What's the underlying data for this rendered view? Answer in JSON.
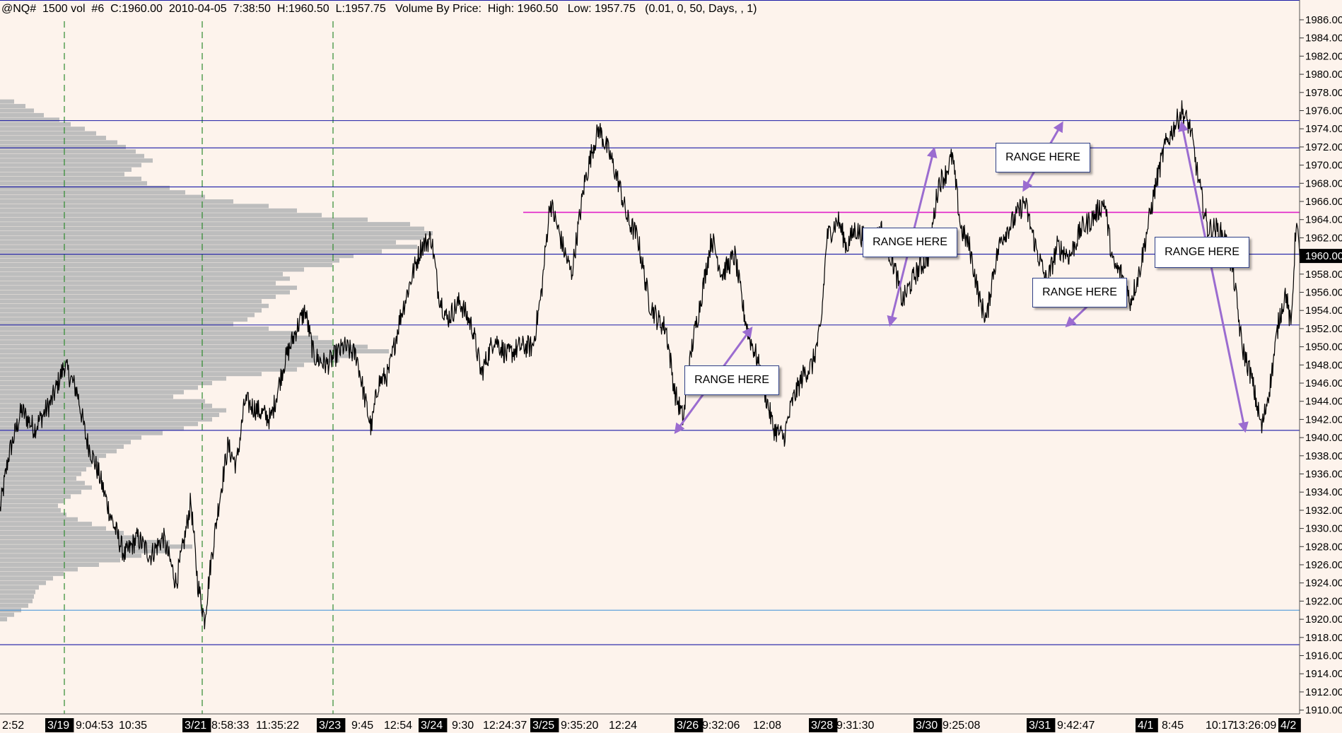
{
  "header": {
    "text": "@NQ#  1500 vol  #6  C:1960.00  2010-04-05  7:38:50  H:1960.50  L:1957.75   Volume By Price:  High: 1960.50   Low: 1957.75   (0.01, 0, 50, Days, , 1)"
  },
  "colors": {
    "background": "#fdf3ec",
    "price_line": "#000000",
    "profile_bars": "#bdbdbd",
    "support_lines": "#1a1aa6",
    "light_line": "#3a8fd8",
    "magenta_line": "#e020c8",
    "session_lines": "#2e8b2e",
    "arrows": "#9b6cd0",
    "current_price_tag": "#000000"
  },
  "annotations": [
    {
      "label": "RANGE HERE"
    },
    {
      "label": "RANGE HERE"
    },
    {
      "label": "RANGE HERE"
    },
    {
      "label": "RANGE HERE"
    },
    {
      "label": "RANGE HERE"
    }
  ],
  "chart_data": {
    "type": "line",
    "ylim": [
      1909.5,
      1987.5
    ],
    "y_ticks": [
      "1986.00",
      "1984.00",
      "1982.00",
      "1980.00",
      "1978.00",
      "1976.00",
      "1974.00",
      "1972.00",
      "1970.00",
      "1968.00",
      "1966.00",
      "1964.00",
      "1962.00",
      "1960.00",
      "1958.00",
      "1956.00",
      "1954.00",
      "1952.00",
      "1950.00",
      "1948.00",
      "1946.00",
      "1944.00",
      "1942.00",
      "1940.00",
      "1938.00",
      "1936.00",
      "1934.00",
      "1932.00",
      "1930.00",
      "1928.00",
      "1926.00",
      "1924.00",
      "1922.00",
      "1920.00",
      "1918.00",
      "1916.00",
      "1914.00",
      "1912.00",
      "1910.00"
    ],
    "current_price": "1960.00",
    "x_labels": [
      {
        "text": "2:52",
        "boxed": false
      },
      {
        "text": "3/19",
        "boxed": true
      },
      {
        "text": "9:04:53",
        "boxed": false
      },
      {
        "text": "10:35",
        "boxed": false
      },
      {
        "text": "3/21",
        "boxed": true
      },
      {
        "text": "8:58:33",
        "boxed": false
      },
      {
        "text": "11:35:22",
        "boxed": false
      },
      {
        "text": "3/23",
        "boxed": true
      },
      {
        "text": "9:45",
        "boxed": false
      },
      {
        "text": "12:54",
        "boxed": false
      },
      {
        "text": "3/24",
        "boxed": true
      },
      {
        "text": "9:30",
        "boxed": false
      },
      {
        "text": "12:24:37",
        "boxed": false
      },
      {
        "text": "3/25",
        "boxed": true
      },
      {
        "text": "9:35:20",
        "boxed": false
      },
      {
        "text": "12:24",
        "boxed": false
      },
      {
        "text": "3/26",
        "boxed": true
      },
      {
        "text": "9:32:06",
        "boxed": false
      },
      {
        "text": "12:08",
        "boxed": false
      },
      {
        "text": "3/28",
        "boxed": true
      },
      {
        "text": "9:31:30",
        "boxed": false
      },
      {
        "text": "3/30",
        "boxed": true
      },
      {
        "text": "9:25:08",
        "boxed": false
      },
      {
        "text": "3/31",
        "boxed": true
      },
      {
        "text": "9:42:47",
        "boxed": false
      },
      {
        "text": "4/1",
        "boxed": true
      },
      {
        "text": "8:45",
        "boxed": false
      },
      {
        "text": "10:17",
        "boxed": false
      },
      {
        "text": "13:26:09",
        "boxed": false
      },
      {
        "text": "4/2",
        "boxed": true
      }
    ],
    "horizontal_levels": [
      {
        "price": 1974.9,
        "style": "dark"
      },
      {
        "price": 1971.9,
        "style": "dark"
      },
      {
        "price": 1967.6,
        "style": "dark"
      },
      {
        "price": 1964.8,
        "style": "magenta"
      },
      {
        "price": 1960.2,
        "style": "dark"
      },
      {
        "price": 1952.4,
        "style": "dark"
      },
      {
        "price": 1940.8,
        "style": "dark"
      },
      {
        "price": 1921.0,
        "style": "light"
      },
      {
        "price": 1917.2,
        "style": "dark"
      }
    ],
    "price_keypoints": [
      [
        0,
        1932
      ],
      [
        10,
        1938
      ],
      [
        25,
        1943
      ],
      [
        40,
        1941
      ],
      [
        60,
        1944
      ],
      [
        75,
        1948
      ],
      [
        90,
        1945
      ],
      [
        100,
        1940
      ],
      [
        115,
        1936
      ],
      [
        130,
        1931
      ],
      [
        145,
        1927
      ],
      [
        160,
        1929
      ],
      [
        175,
        1927
      ],
      [
        190,
        1929
      ],
      [
        205,
        1924
      ],
      [
        215,
        1929
      ],
      [
        222,
        1933
      ],
      [
        230,
        1924
      ],
      [
        238,
        1920
      ],
      [
        245,
        1926
      ],
      [
        255,
        1933
      ],
      [
        265,
        1939
      ],
      [
        275,
        1937
      ],
      [
        285,
        1944
      ],
      [
        300,
        1943
      ],
      [
        315,
        1942
      ],
      [
        330,
        1948
      ],
      [
        345,
        1952
      ],
      [
        355,
        1954
      ],
      [
        365,
        1949
      ],
      [
        380,
        1948
      ],
      [
        400,
        1950
      ],
      [
        415,
        1949
      ],
      [
        425,
        1944
      ],
      [
        432,
        1941
      ],
      [
        440,
        1946
      ],
      [
        452,
        1947
      ],
      [
        465,
        1953
      ],
      [
        480,
        1958
      ],
      [
        490,
        1961
      ],
      [
        502,
        1962
      ],
      [
        510,
        1956
      ],
      [
        520,
        1953
      ],
      [
        535,
        1955
      ],
      [
        550,
        1952
      ],
      [
        560,
        1947
      ],
      [
        575,
        1951
      ],
      [
        590,
        1949
      ],
      [
        605,
        1950
      ],
      [
        620,
        1950
      ],
      [
        630,
        1956
      ],
      [
        640,
        1966
      ],
      [
        655,
        1961
      ],
      [
        665,
        1958
      ],
      [
        680,
        1968
      ],
      [
        690,
        1972
      ],
      [
        697,
        1974
      ],
      [
        710,
        1971
      ],
      [
        720,
        1968
      ],
      [
        730,
        1964
      ],
      [
        742,
        1962
      ],
      [
        755,
        1955
      ],
      [
        765,
        1953
      ],
      [
        775,
        1952
      ],
      [
        785,
        1945
      ],
      [
        795,
        1942
      ],
      [
        805,
        1950
      ],
      [
        815,
        1955
      ],
      [
        828,
        1962
      ],
      [
        840,
        1958
      ],
      [
        855,
        1960
      ],
      [
        865,
        1954
      ],
      [
        872,
        1951
      ],
      [
        880,
        1949
      ],
      [
        890,
        1945
      ],
      [
        900,
        1941
      ],
      [
        912,
        1940
      ],
      [
        922,
        1944
      ],
      [
        935,
        1947
      ],
      [
        945,
        1948
      ],
      [
        955,
        1952
      ],
      [
        962,
        1962
      ],
      [
        975,
        1964
      ],
      [
        985,
        1961
      ],
      [
        995,
        1963
      ],
      [
        1005,
        1962
      ],
      [
        1015,
        1961
      ],
      [
        1025,
        1963
      ],
      [
        1040,
        1959
      ],
      [
        1050,
        1955
      ],
      [
        1065,
        1958
      ],
      [
        1080,
        1960
      ],
      [
        1092,
        1968
      ],
      [
        1100,
        1969
      ],
      [
        1108,
        1971
      ],
      [
        1118,
        1963
      ],
      [
        1128,
        1961
      ],
      [
        1140,
        1955
      ],
      [
        1148,
        1953
      ],
      [
        1155,
        1958
      ],
      [
        1165,
        1962
      ],
      [
        1180,
        1964
      ],
      [
        1192,
        1966
      ],
      [
        1205,
        1961
      ],
      [
        1218,
        1957
      ],
      [
        1230,
        1961
      ],
      [
        1245,
        1960
      ],
      [
        1258,
        1963
      ],
      [
        1270,
        1964
      ],
      [
        1285,
        1966
      ],
      [
        1295,
        1959
      ],
      [
        1305,
        1958
      ],
      [
        1315,
        1955
      ],
      [
        1325,
        1958
      ],
      [
        1335,
        1963
      ],
      [
        1345,
        1968
      ],
      [
        1355,
        1972
      ],
      [
        1365,
        1974
      ],
      [
        1375,
        1976
      ],
      [
        1385,
        1974
      ],
      [
        1395,
        1968
      ],
      [
        1405,
        1963
      ],
      [
        1415,
        1963
      ],
      [
        1425,
        1962
      ],
      [
        1435,
        1958
      ],
      [
        1445,
        1950
      ],
      [
        1455,
        1947
      ],
      [
        1468,
        1941
      ],
      [
        1478,
        1946
      ],
      [
        1488,
        1953
      ],
      [
        1496,
        1956
      ],
      [
        1502,
        1952
      ],
      [
        1508,
        1964
      ],
      [
        1512,
        1960
      ]
    ],
    "volume_profile": [
      [
        1977,
        20
      ],
      [
        1976.5,
        36
      ],
      [
        1976,
        48
      ],
      [
        1975.5,
        62
      ],
      [
        1975,
        84
      ],
      [
        1974.5,
        100
      ],
      [
        1974,
        120
      ],
      [
        1973.5,
        136
      ],
      [
        1973,
        150
      ],
      [
        1972.5,
        166
      ],
      [
        1972,
        178
      ],
      [
        1971.5,
        192
      ],
      [
        1971,
        204
      ],
      [
        1970.5,
        216
      ],
      [
        1970,
        200
      ],
      [
        1969.5,
        186
      ],
      [
        1969,
        176
      ],
      [
        1968.5,
        200
      ],
      [
        1968,
        208
      ],
      [
        1967.5,
        240
      ],
      [
        1967,
        262
      ],
      [
        1966.5,
        290
      ],
      [
        1966,
        330
      ],
      [
        1965.5,
        380
      ],
      [
        1965,
        420
      ],
      [
        1964.5,
        455
      ],
      [
        1964,
        520
      ],
      [
        1963.5,
        580
      ],
      [
        1963,
        600
      ],
      [
        1962.5,
        612
      ],
      [
        1962,
        600
      ],
      [
        1961.5,
        560
      ],
      [
        1961,
        590
      ],
      [
        1960.5,
        540
      ],
      [
        1960,
        500
      ],
      [
        1959.5,
        480
      ],
      [
        1959,
        470
      ],
      [
        1958.5,
        430
      ],
      [
        1958,
        400
      ],
      [
        1957.5,
        410
      ],
      [
        1957,
        390
      ],
      [
        1956.5,
        420
      ],
      [
        1956,
        410
      ],
      [
        1955.5,
        390
      ],
      [
        1955,
        370
      ],
      [
        1954.5,
        380
      ],
      [
        1954,
        370
      ],
      [
        1953.5,
        360
      ],
      [
        1953,
        350
      ],
      [
        1952.5,
        330
      ],
      [
        1952,
        380
      ],
      [
        1951.5,
        420
      ],
      [
        1951,
        450
      ],
      [
        1950.5,
        470
      ],
      [
        1950,
        520
      ],
      [
        1949.5,
        550
      ],
      [
        1949,
        500
      ],
      [
        1948.5,
        480
      ],
      [
        1948,
        430
      ],
      [
        1947.5,
        420
      ],
      [
        1947,
        370
      ],
      [
        1946.5,
        320
      ],
      [
        1946,
        300
      ],
      [
        1945.5,
        280
      ],
      [
        1945,
        260
      ],
      [
        1944.5,
        245
      ],
      [
        1944,
        290
      ],
      [
        1943.5,
        300
      ],
      [
        1943,
        320
      ],
      [
        1942.5,
        310
      ],
      [
        1942,
        300
      ],
      [
        1941.5,
        280
      ],
      [
        1941,
        260
      ],
      [
        1940.5,
        230
      ],
      [
        1940,
        200
      ],
      [
        1939.5,
        185
      ],
      [
        1939,
        175
      ],
      [
        1938.5,
        165
      ],
      [
        1938,
        150
      ],
      [
        1937.5,
        140
      ],
      [
        1937,
        130
      ],
      [
        1936.5,
        122
      ],
      [
        1936,
        115
      ],
      [
        1935.5,
        108
      ],
      [
        1935,
        120
      ],
      [
        1934.5,
        130
      ],
      [
        1934,
        115
      ],
      [
        1933.5,
        100
      ],
      [
        1933,
        90
      ],
      [
        1932.5,
        82
      ],
      [
        1932,
        86
      ],
      [
        1931.5,
        94
      ],
      [
        1931,
        110
      ],
      [
        1930.5,
        130
      ],
      [
        1930,
        150
      ],
      [
        1929.5,
        175
      ],
      [
        1929,
        200
      ],
      [
        1928.5,
        240
      ],
      [
        1928,
        272
      ],
      [
        1927.5,
        240
      ],
      [
        1927,
        200
      ],
      [
        1926.5,
        170
      ],
      [
        1926,
        140
      ],
      [
        1925.5,
        110
      ],
      [
        1925,
        90
      ],
      [
        1924.5,
        75
      ],
      [
        1924,
        65
      ],
      [
        1923.5,
        55
      ],
      [
        1923,
        50
      ],
      [
        1922.5,
        48
      ],
      [
        1922,
        46
      ],
      [
        1921.5,
        40
      ],
      [
        1921,
        30
      ],
      [
        1920.5,
        20
      ],
      [
        1920,
        10
      ]
    ]
  }
}
